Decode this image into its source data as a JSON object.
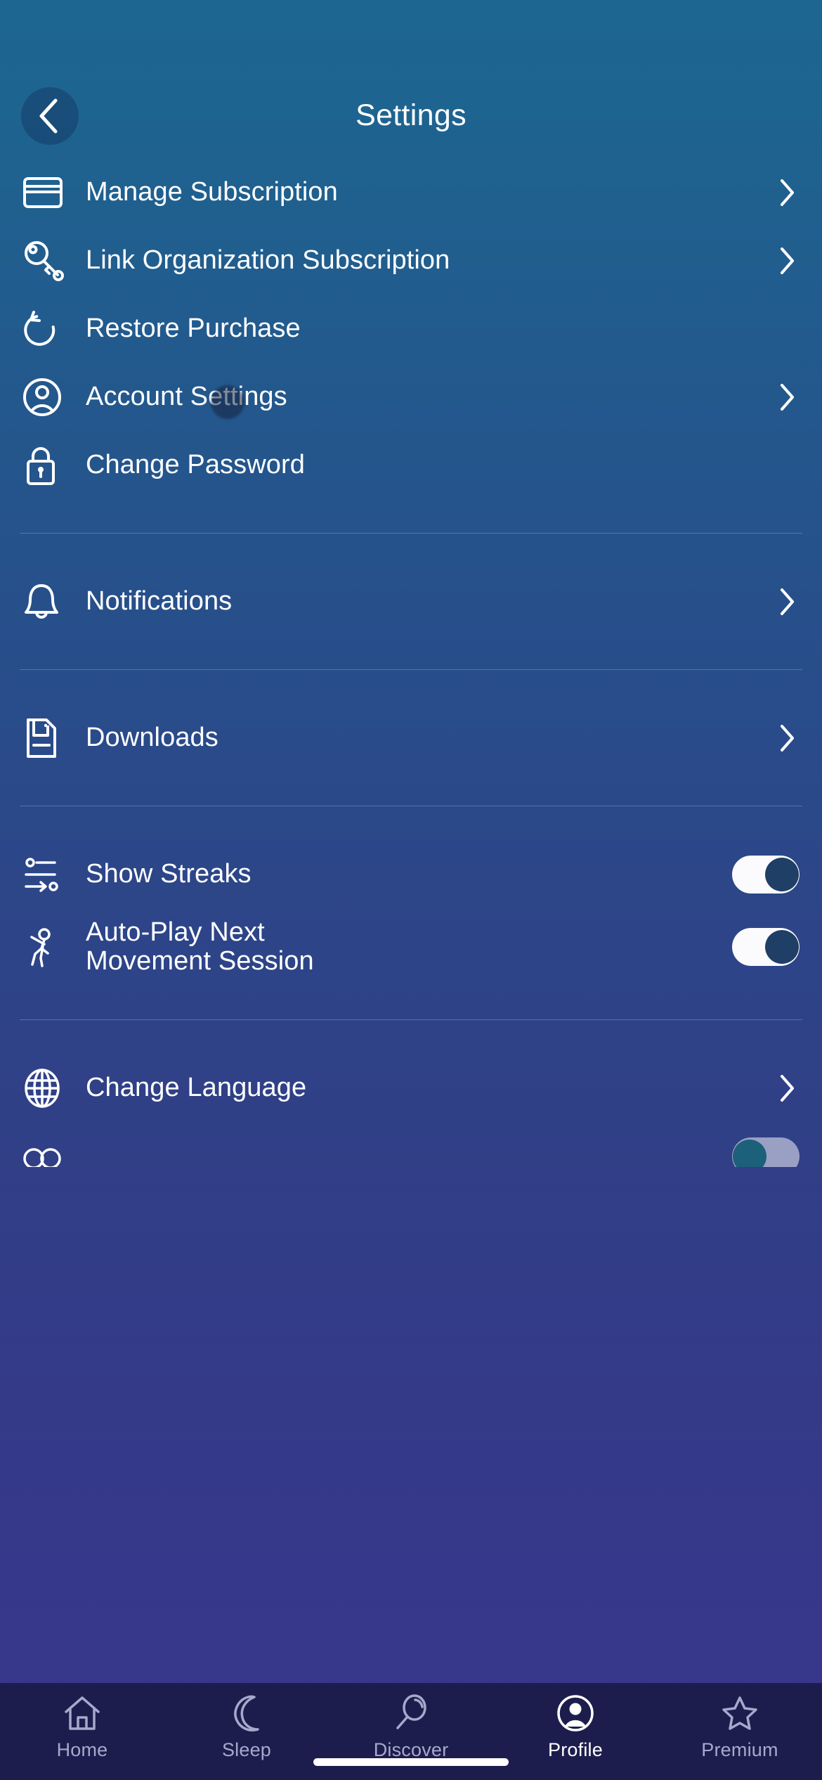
{
  "header": {
    "title": "Settings",
    "back_icon": "chevron-left-icon"
  },
  "sections": [
    {
      "id": "account",
      "rows": [
        {
          "label": "Manage Subscription",
          "icon": "credit-card-icon",
          "chevron": true,
          "type": "link"
        },
        {
          "label": "Link Organization Subscription",
          "icon": "key-icon",
          "chevron": true,
          "type": "link"
        },
        {
          "label": "Restore Purchase",
          "icon": "restore-icon",
          "chevron": false,
          "type": "link"
        },
        {
          "label": "Account Settings",
          "icon": "user-circle-icon",
          "chevron": true,
          "type": "link"
        },
        {
          "label": "Change Password",
          "icon": "lock-icon",
          "chevron": false,
          "type": "link"
        }
      ]
    },
    {
      "id": "notifications",
      "rows": [
        {
          "label": "Notifications",
          "icon": "bell-icon",
          "chevron": true,
          "type": "link"
        }
      ]
    },
    {
      "id": "downloads",
      "rows": [
        {
          "label": "Downloads",
          "icon": "document-icon",
          "chevron": true,
          "type": "link"
        }
      ]
    },
    {
      "id": "preferences",
      "rows": [
        {
          "label": "Show Streaks",
          "icon": "streaks-icon",
          "type": "toggle",
          "toggle_state": "on"
        },
        {
          "label_line1": "Auto-Play Next",
          "label_line2": "Movement Session",
          "icon": "movement-icon",
          "type": "toggle",
          "toggle_state": "on"
        }
      ]
    },
    {
      "id": "language",
      "rows": [
        {
          "label": "Change Language",
          "icon": "globe-icon",
          "chevron": true,
          "type": "link"
        },
        {
          "label": "",
          "icon": "clipped-icon",
          "type": "toggle",
          "toggle_state": "off"
        }
      ]
    }
  ],
  "tabbar": {
    "tabs": [
      {
        "label": "Home",
        "icon": "home-icon",
        "active": false
      },
      {
        "label": "Sleep",
        "icon": "moon-icon",
        "active": false
      },
      {
        "label": "Discover",
        "icon": "search-icon",
        "active": false
      },
      {
        "label": "Profile",
        "icon": "profile-avatar-icon",
        "active": true
      },
      {
        "label": "Premium",
        "icon": "star-icon",
        "active": false
      }
    ]
  },
  "colors": {
    "bg_top": "#1c6691",
    "bg_bottom": "#38368e",
    "tabbar_bg": "#1d1d4d",
    "text": "#ffffff",
    "text_muted": "#a6a9cc",
    "toggle_on_track": "#fbfbfd",
    "toggle_on_knob": "#1f3f66",
    "toggle_off_track": "#9aa0c4",
    "toggle_off_knob": "#1d6079"
  }
}
